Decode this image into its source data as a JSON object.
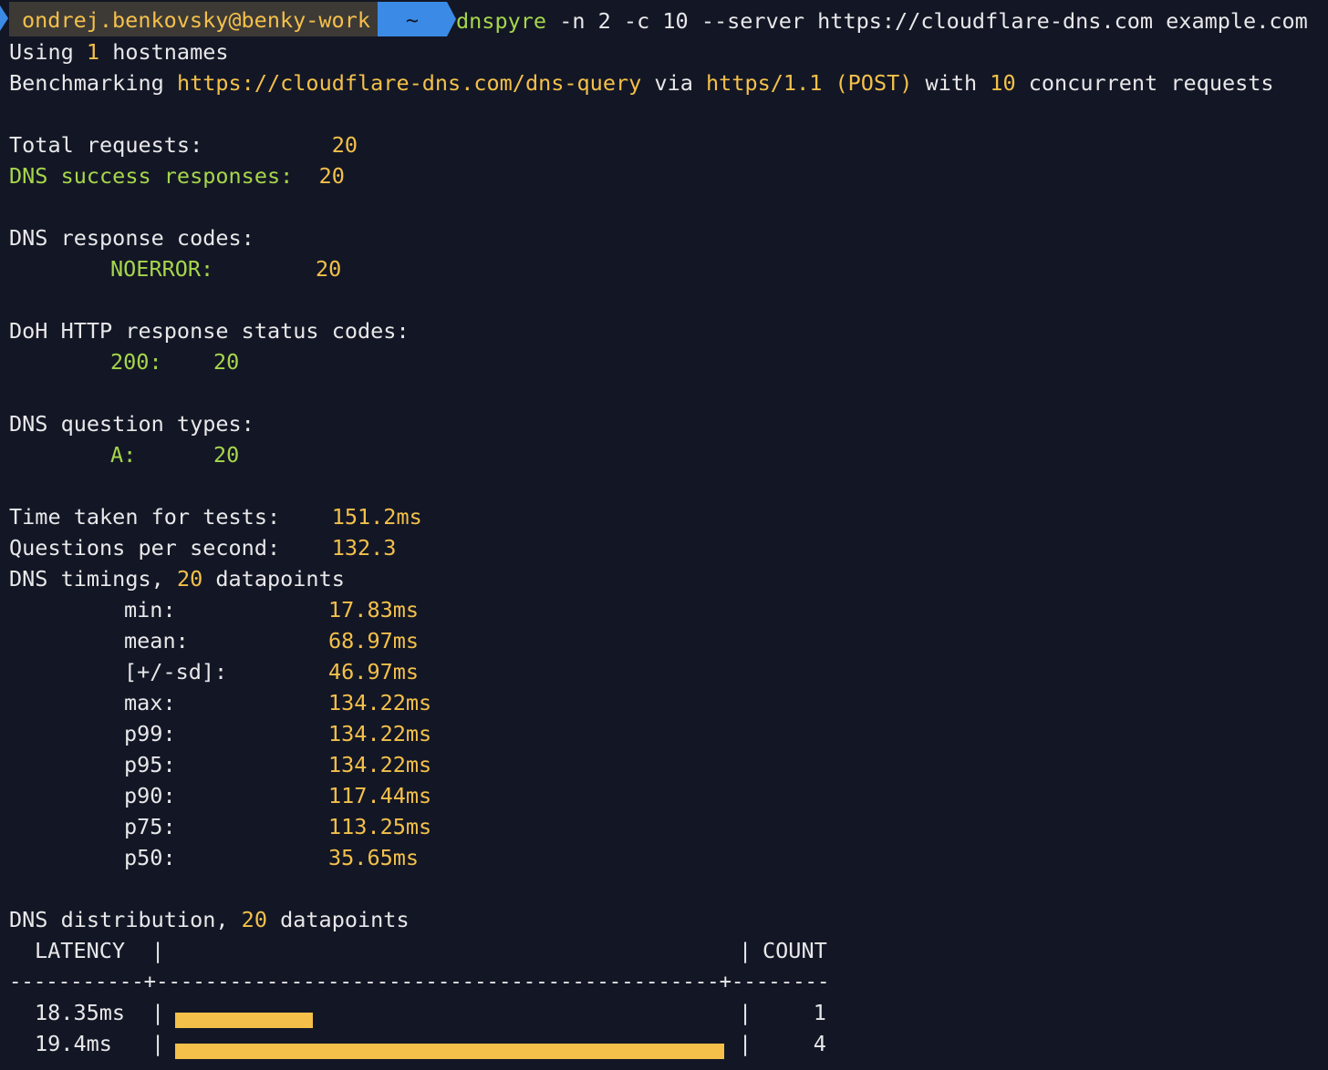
{
  "prompt": {
    "user_host": "ondrej.benkovsky@benky-work",
    "dir": "~",
    "cmd_name": "dnspyre",
    "cmd_args": " -n 2 -c 10 --server https://cloudflare-dns.com example.com"
  },
  "header": {
    "using_prefix": "Using ",
    "hostnames_count": "1",
    "using_suffix": " hostnames",
    "bench_prefix": "Benchmarking ",
    "bench_url": "https://cloudflare-dns.com/dns-query",
    "bench_via": " via ",
    "bench_proto": "https/1.1 (POST)",
    "bench_with": " with ",
    "bench_concurrency": "10",
    "bench_suffix": " concurrent requests"
  },
  "totals": {
    "total_label": "Total requests:          ",
    "total_value": "20",
    "success_label": "DNS success responses:  ",
    "success_value": "20"
  },
  "response_codes": {
    "title": "DNS response codes:",
    "code_label": "NOERROR:",
    "code_value": "20"
  },
  "doh_codes": {
    "title": "DoH HTTP response status codes:",
    "code_label": "200:",
    "code_value": "20"
  },
  "question_types": {
    "title": "DNS question types:",
    "type_label": "A:",
    "type_value": "20"
  },
  "timing": {
    "time_label": "Time taken for tests:    ",
    "time_value": "151.2ms",
    "qps_label": "Questions per second:    ",
    "qps_value": "132.3",
    "dp_prefix": "DNS timings, ",
    "dp_count": "20",
    "dp_suffix": " datapoints",
    "stats": [
      {
        "label": "min:",
        "value": "17.83ms"
      },
      {
        "label": "mean:",
        "value": "68.97ms"
      },
      {
        "label": "[+/-sd]:",
        "value": "46.97ms"
      },
      {
        "label": "max:",
        "value": "134.22ms"
      },
      {
        "label": "p99:",
        "value": "134.22ms"
      },
      {
        "label": "p95:",
        "value": "134.22ms"
      },
      {
        "label": "p90:",
        "value": "117.44ms"
      },
      {
        "label": "p75:",
        "value": "113.25ms"
      },
      {
        "label": "p50:",
        "value": "35.65ms"
      }
    ]
  },
  "distribution": {
    "title_prefix": "DNS distribution, ",
    "title_count": "20",
    "title_suffix": " datapoints",
    "col_latency": "LATENCY",
    "col_count": "COUNT",
    "pipe": "|",
    "separator": "-----------+----------------------------------------------+--------",
    "rows": [
      {
        "latency": "18.35ms",
        "count": "1",
        "fill": 0.25
      },
      {
        "latency": "19.4ms",
        "count": "4",
        "fill": 1.0
      }
    ]
  },
  "colors": {
    "background": "#131725",
    "yellow": "#f4c04a",
    "green": "#a6d64b",
    "prompt_blue": "#3b8be6"
  }
}
